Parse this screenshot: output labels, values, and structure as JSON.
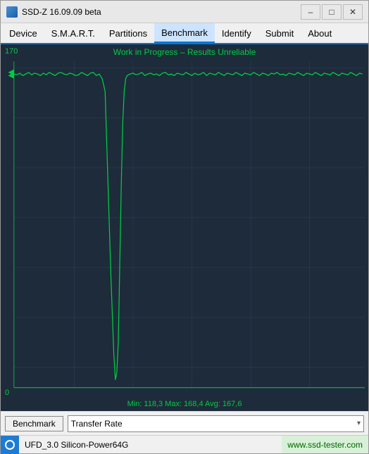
{
  "window": {
    "title": "SSD-Z 16.09.09 beta",
    "icon": "ssd-icon"
  },
  "titlebar": {
    "minimize_label": "–",
    "maximize_label": "□",
    "close_label": "✕"
  },
  "menu": {
    "items": [
      {
        "label": "Device",
        "active": false
      },
      {
        "label": "S.M.A.R.T.",
        "active": false
      },
      {
        "label": "Partitions",
        "active": false
      },
      {
        "label": "Benchmark",
        "active": true
      },
      {
        "label": "Identify",
        "active": false
      },
      {
        "label": "Submit",
        "active": false
      },
      {
        "label": "About",
        "active": false
      }
    ]
  },
  "chart": {
    "title": "Work in Progress – Results Unreliable",
    "y_max": "170",
    "y_min": "0",
    "stats": "Min: 118,3   Max: 168,4   Avg: 167,6"
  },
  "toolbar": {
    "benchmark_label": "Benchmark",
    "dropdown_value": "Transfer Rate",
    "dropdown_arrow": "▾"
  },
  "statusbar": {
    "device_name": "UFD_3.0 Silicon-Power64G",
    "url": "www.ssd-tester.com"
  }
}
